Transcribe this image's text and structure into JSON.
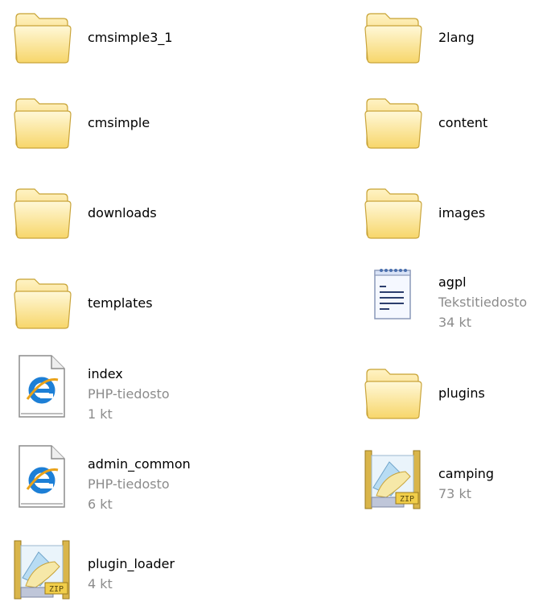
{
  "items": [
    {
      "name": "cmsimple3_1",
      "type": "",
      "size": "",
      "icon": "folder-icon"
    },
    {
      "name": "2lang",
      "type": "",
      "size": "",
      "icon": "folder-icon"
    },
    {
      "name": "cmsimple",
      "type": "",
      "size": "",
      "icon": "folder-icon"
    },
    {
      "name": "content",
      "type": "",
      "size": "",
      "icon": "folder-icon"
    },
    {
      "name": "downloads",
      "type": "",
      "size": "",
      "icon": "folder-icon"
    },
    {
      "name": "images",
      "type": "",
      "size": "",
      "icon": "folder-icon"
    },
    {
      "name": "templates",
      "type": "",
      "size": "",
      "icon": "folder-icon"
    },
    {
      "name": "agpl",
      "type": "Tekstitiedosto",
      "size": "34 kt",
      "icon": "text-file-icon"
    },
    {
      "name": "index",
      "type": "PHP-tiedosto",
      "size": "1 kt",
      "icon": "php-file-icon"
    },
    {
      "name": "plugins",
      "type": "",
      "size": "",
      "icon": "folder-icon"
    },
    {
      "name": "admin_common",
      "type": "PHP-tiedosto",
      "size": "6 kt",
      "icon": "php-file-icon"
    },
    {
      "name": "camping",
      "type": "",
      "size": "73 kt",
      "icon": "zip-archive-icon"
    },
    {
      "name": "plugin_loader",
      "type": "",
      "size": "4 kt",
      "icon": "zip-archive-icon"
    }
  ]
}
